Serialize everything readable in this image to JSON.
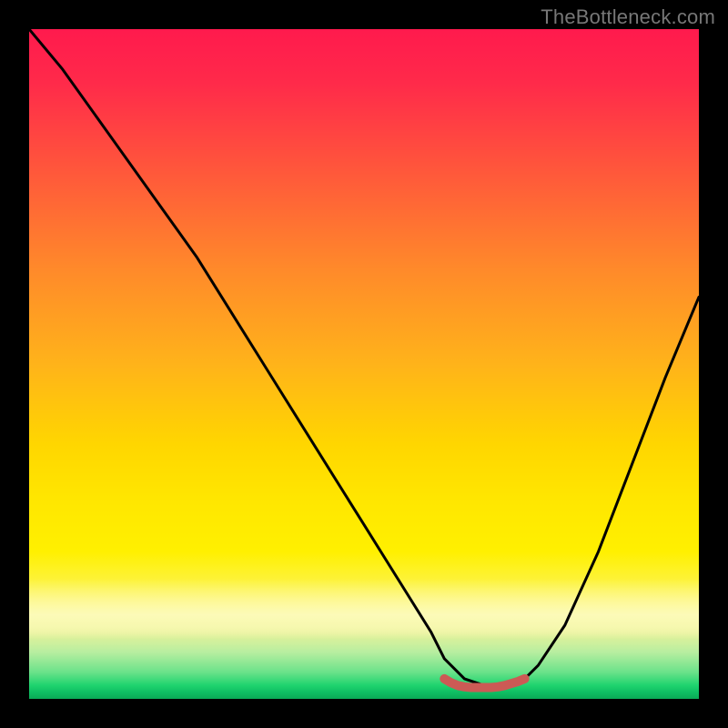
{
  "watermark": "TheBottleneck.com",
  "colors": {
    "gradient_top": "#ff1a4d",
    "gradient_mid": "#ffe600",
    "gradient_bottom": "#0aa956",
    "curve": "#000000",
    "marker": "#cc5a55"
  },
  "chart_data": {
    "type": "line",
    "title": "",
    "xlabel": "",
    "ylabel": "",
    "xlim": [
      0,
      100
    ],
    "ylim": [
      0,
      100
    ],
    "grid": false,
    "series": [
      {
        "name": "curve",
        "x": [
          0,
          5,
          10,
          15,
          20,
          25,
          30,
          35,
          40,
          45,
          50,
          55,
          60,
          62,
          65,
          68,
          70,
          72,
          74,
          76,
          80,
          85,
          90,
          95,
          100
        ],
        "y": [
          100,
          94,
          87,
          80,
          73,
          66,
          58,
          50,
          42,
          34,
          26,
          18,
          10,
          6,
          3,
          2,
          2,
          2,
          3,
          5,
          11,
          22,
          35,
          48,
          60
        ]
      },
      {
        "name": "bottom-marker",
        "x": [
          62,
          63,
          64,
          65,
          66,
          67,
          68,
          69,
          70,
          71,
          72,
          73,
          74
        ],
        "y": [
          3.0,
          2.4,
          2.0,
          1.8,
          1.7,
          1.7,
          1.7,
          1.7,
          1.8,
          2.0,
          2.3,
          2.6,
          3.0
        ]
      }
    ],
    "annotations": []
  }
}
